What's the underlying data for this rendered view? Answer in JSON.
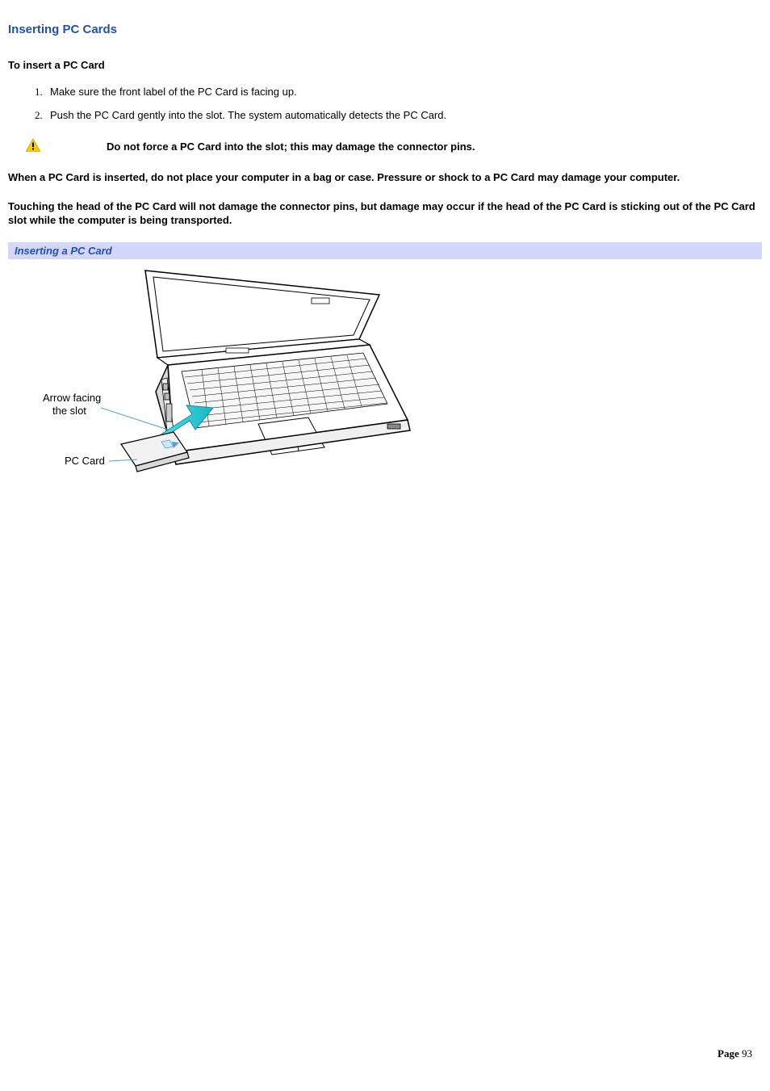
{
  "title": "Inserting PC Cards",
  "subhead": "To insert a PC Card",
  "steps": [
    "Make sure the front label of the PC Card is facing up.",
    "Push the PC Card gently into the slot. The system automatically detects the PC Card."
  ],
  "warning": "Do not force a PC Card into the slot; this may damage the connector pins.",
  "paragraphs": [
    "When a PC Card is inserted, do not place your computer in a bag or case. Pressure or shock to a PC Card may damage your computer.",
    "Touching the head of the PC Card will not damage the connector pins, but damage may occur if the head of the PC Card is sticking out of the PC Card slot while the computer is being transported."
  ],
  "caption": "Inserting a PC Card",
  "figure": {
    "arrow_label_l1": "Arrow facing",
    "arrow_label_l2": "the slot",
    "card_label": "PC Card"
  },
  "page_label": "Page",
  "page_number": "93"
}
